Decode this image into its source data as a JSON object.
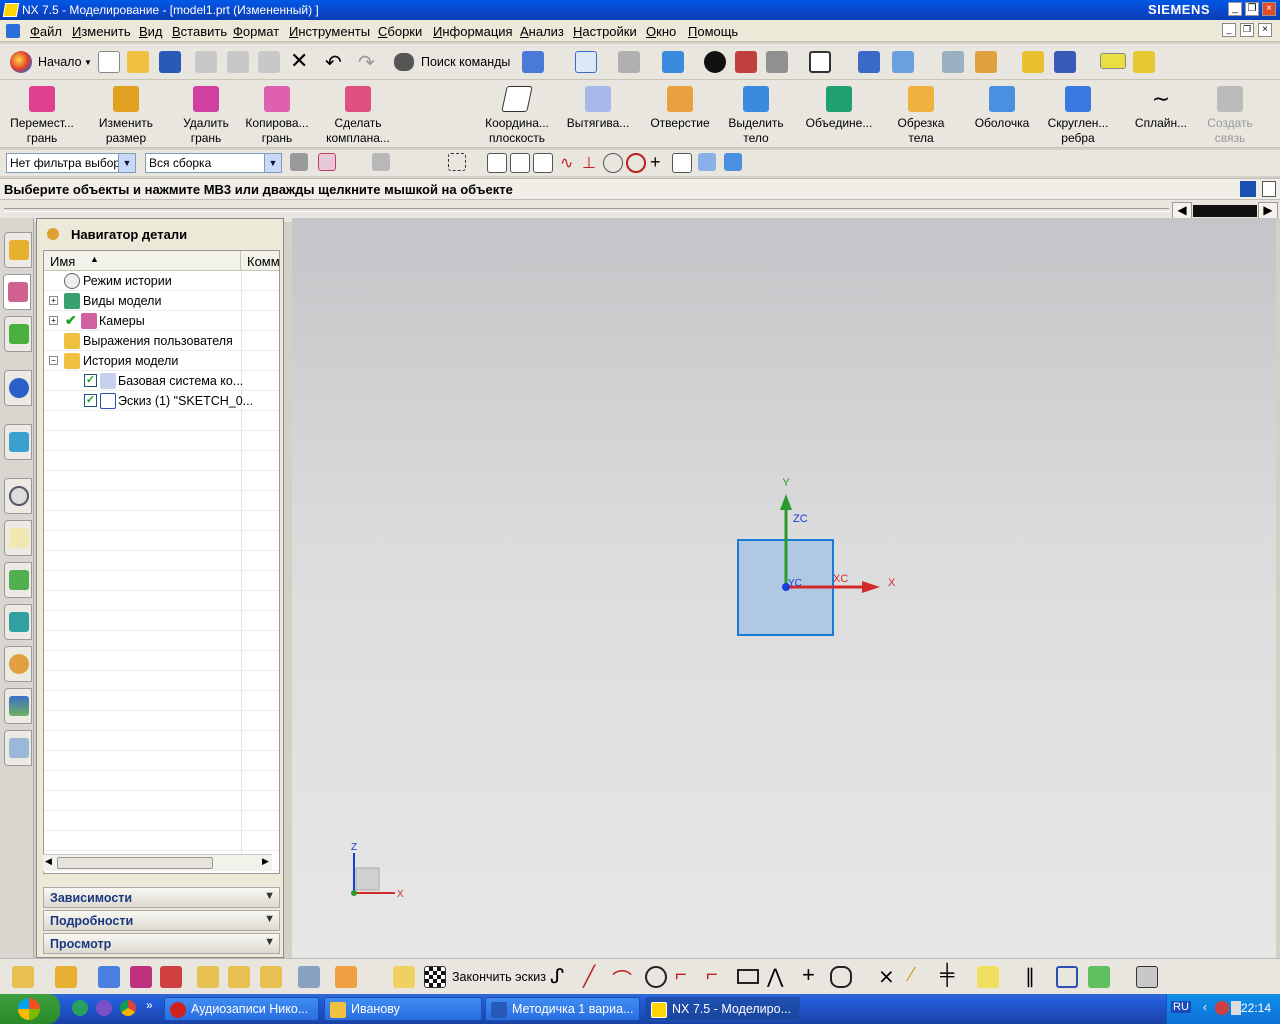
{
  "window": {
    "title": "NX 7.5 - Моделирование - [model1.prt (Измененный) ]",
    "brand": "SIEMENS"
  },
  "menu": [
    "Файл",
    "Изменить",
    "Вид",
    "Вставить",
    "Формат",
    "Инструменты",
    "Сборки",
    "Информация",
    "Анализ",
    "Настройки",
    "Окно",
    "Помощь"
  ],
  "standard_toolbar": {
    "start_label": "Начало",
    "find_command_label": "Поиск команды"
  },
  "feature_toolbar": [
    {
      "line1": "Перемест...",
      "line2": "грань"
    },
    {
      "line1": "Изменить",
      "line2": "размер"
    },
    {
      "line1": "Удалить",
      "line2": "грань"
    },
    {
      "line1": "Копирова...",
      "line2": "грань"
    },
    {
      "line1": "Сделать",
      "line2": "компланa..."
    },
    {
      "line1": "Координа...",
      "line2": "плоскость"
    },
    {
      "line1": "Вытягива...",
      "line2": ""
    },
    {
      "line1": "Отверстие",
      "line2": ""
    },
    {
      "line1": "Выделить",
      "line2": "тело"
    },
    {
      "line1": "Объедине...",
      "line2": ""
    },
    {
      "line1": "Обрезка",
      "line2": "тела"
    },
    {
      "line1": "Оболочка",
      "line2": ""
    },
    {
      "line1": "Скруглен...",
      "line2": "ребра"
    },
    {
      "line1": "Сплайн...",
      "line2": ""
    },
    {
      "line1": "Создать",
      "line2": "связь"
    }
  ],
  "selection": {
    "filter": "Нет фильтра выбор",
    "scope": "Вся сборка"
  },
  "prompt": "Выберите объекты и нажмите МВ3 или дважды щелкните мышкой на объекте",
  "navigator": {
    "title": "Навигатор детали",
    "col_name": "Имя",
    "col_comment": "Комм",
    "rows": [
      {
        "label": "Режим истории"
      },
      {
        "label": "Виды модели"
      },
      {
        "label": "Камеры"
      },
      {
        "label": "Выражения пользователя"
      },
      {
        "label": "История модели"
      },
      {
        "label": "Базовая система ко..."
      },
      {
        "label": "Эскиз (1) \"SKETCH_0..."
      }
    ],
    "panels": [
      "Зависимости",
      "Подробности",
      "Просмотр"
    ]
  },
  "axes": {
    "y": "Y",
    "zc": "ZC",
    "xc": "XC",
    "x": "X",
    "yc": "YC"
  },
  "triad": {
    "z": "Z",
    "x": "X"
  },
  "sketch_toolbar": {
    "finish_label": "Закончить эскиз"
  },
  "taskbar": {
    "tasks": [
      "Аудиозаписи Нико...",
      "Иванову",
      "Методичка 1 вариа...",
      "NX 7.5 - Моделиро..."
    ],
    "lang": "RU",
    "time": "22:14"
  },
  "colors": {
    "xp_blue": "#245edb",
    "axis_red": "#d22a2a",
    "axis_green": "#2a9a2a",
    "axis_blue": "#1a3cd8",
    "sketch_fill": "#a9c4e3"
  }
}
